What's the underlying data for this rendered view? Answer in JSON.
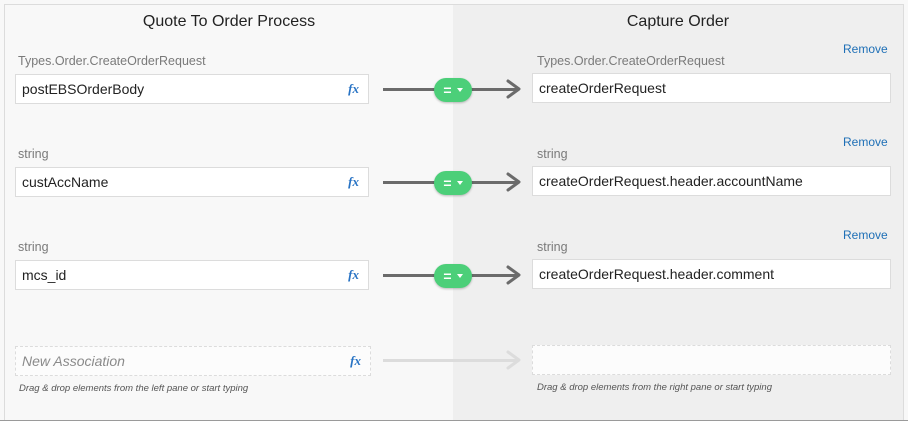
{
  "headers": {
    "left": "Quote To Order Process",
    "right": "Capture Order"
  },
  "remove_label": "Remove",
  "fx_label": "fx",
  "mappings": [
    {
      "type_label": "Types.Order.CreateOrderRequest",
      "source": "postEBSOrderBody",
      "target_type_label": "Types.Order.CreateOrderRequest",
      "target": "createOrderRequest",
      "operator": "="
    },
    {
      "type_label": "string",
      "source": "custAccName",
      "target_type_label": "string",
      "target": "createOrderRequest.header.accountName",
      "operator": "="
    },
    {
      "type_label": "string",
      "source": "mcs_id",
      "target_type_label": "string",
      "target": "createOrderRequest.header.comment",
      "operator": "="
    }
  ],
  "new_association": {
    "placeholder": "New Association",
    "left_hint": "Drag & drop elements from the left pane or start typing",
    "right_hint": "Drag & drop elements from the right pane or start typing"
  },
  "colors": {
    "accent_green": "#4ccf79",
    "link_blue": "#1e6fb6",
    "fx_blue": "#2873c4"
  }
}
